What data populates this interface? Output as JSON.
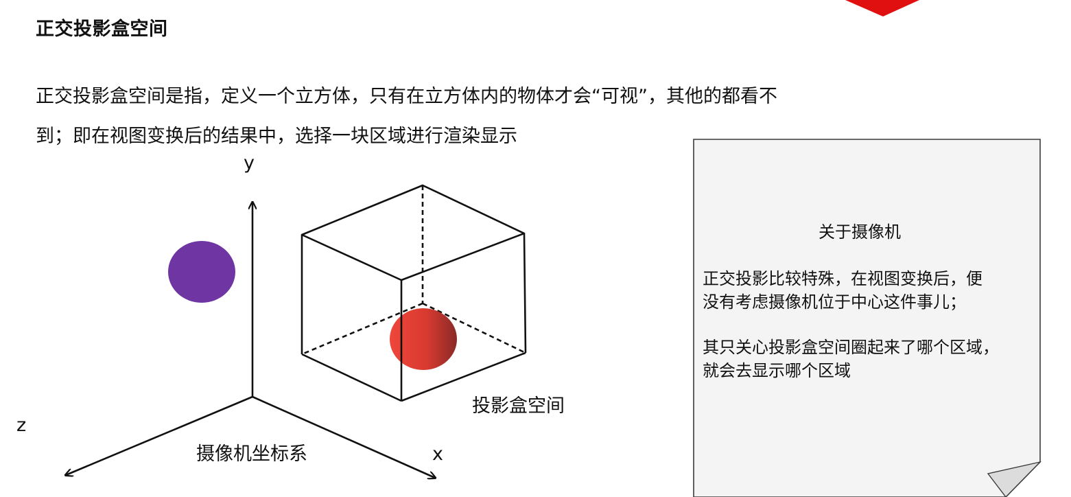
{
  "slide": {
    "title": "正交投影盒空间",
    "paragraph_line1": "正交投影盒空间是指，定义一个立方体，只有在立方体内的物体才会“可视”，其他的都看不",
    "paragraph_line2": "到；即在视图变换后的结果中，选择一块区域进行渲染显示"
  },
  "diagram": {
    "axis_y_label": "y",
    "axis_x_label": "x",
    "axis_z_label": "z",
    "camera_label": "摄像机坐标系",
    "box_label": "投影盒空间",
    "colors": {
      "purple_sphere": "#6f36a3",
      "red_sphere_light": "#f0463a",
      "red_sphere_dark": "#8a2a28",
      "logo_red": "#e01010",
      "note_fill": "#f4f4f4",
      "note_border": "#3a3a3a"
    }
  },
  "note": {
    "title": "关于摄像机",
    "line1": "正交投影比较特殊，在视图变换后，便",
    "line2": "没有考虑摄像机位于中心这件事儿；",
    "line3": "其只关心投影盒空间圈起来了哪个区域，",
    "line4": "就会去显示哪个区域"
  }
}
